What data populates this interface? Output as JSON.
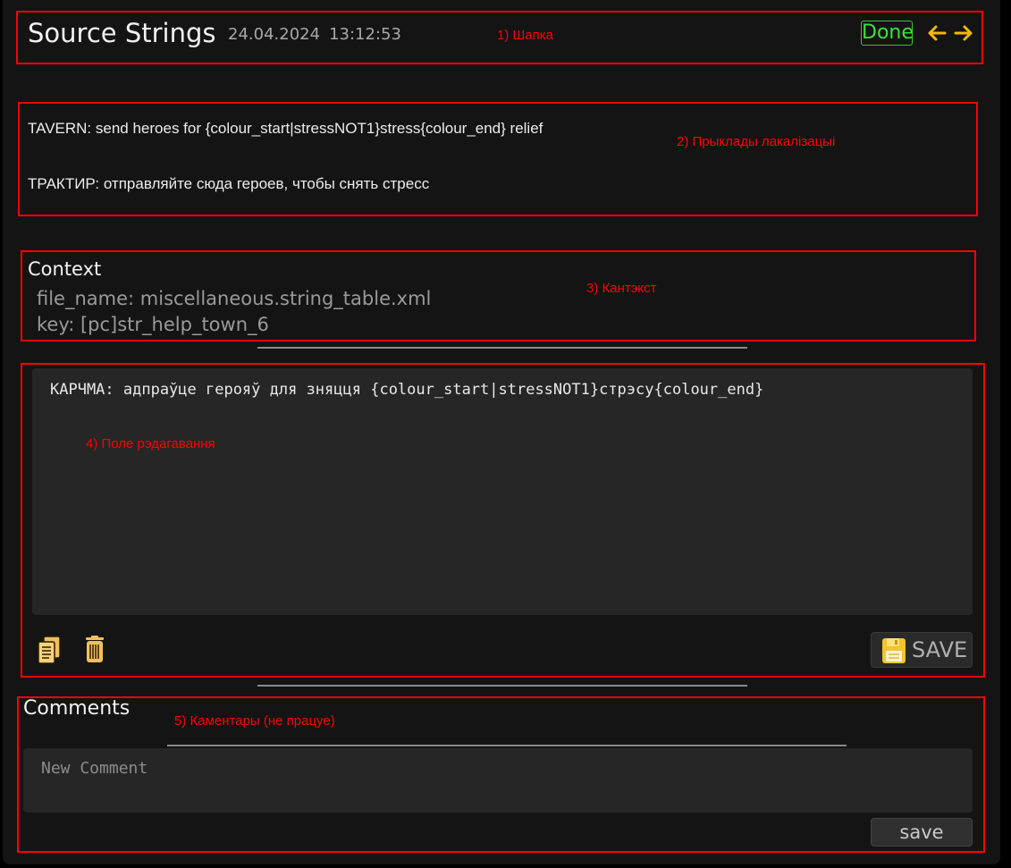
{
  "header": {
    "title": "Source Strings",
    "date": "24.04.2024",
    "time": "13:12:53",
    "done_label": "Done",
    "prev_icon": "arrow-left-icon",
    "next_icon": "arrow-right-icon",
    "annotation": "1) Шапка"
  },
  "examples": {
    "source": "TAVERN: send heroes for {colour_start|stressNOT1}stress{colour_end} relief",
    "reference": "ТРАКТИР: отправляйте сюда героев, чтобы снять стресс",
    "annotation": "2) Прыклады лакалізацыі"
  },
  "context": {
    "heading": "Context",
    "file_name": "file_name: miscellaneous.string_table.xml",
    "key": "key: [pc]str_help_town_6",
    "annotation": "3) Кантэкст"
  },
  "editor": {
    "text": "КАРЧМА: адпраўце герояў для зняцця {colour_start|stressNOT1}стрэсу{colour_end}",
    "copy_icon": "copy-icon",
    "delete_icon": "trash-icon",
    "save_icon": "floppy-disk-icon",
    "save_label": "SAVE",
    "annotation": "4) Поле рэдагавання"
  },
  "comments": {
    "title": "Comments",
    "placeholder": "New Comment",
    "save_label": "save",
    "annotation": "5) Каментары (не працуе)"
  },
  "colors": {
    "background": "#141414",
    "highlight_box": "#ff0000",
    "done_green": "#3be03b",
    "arrow_orange": "#f5b800",
    "input_bg": "#262626"
  }
}
